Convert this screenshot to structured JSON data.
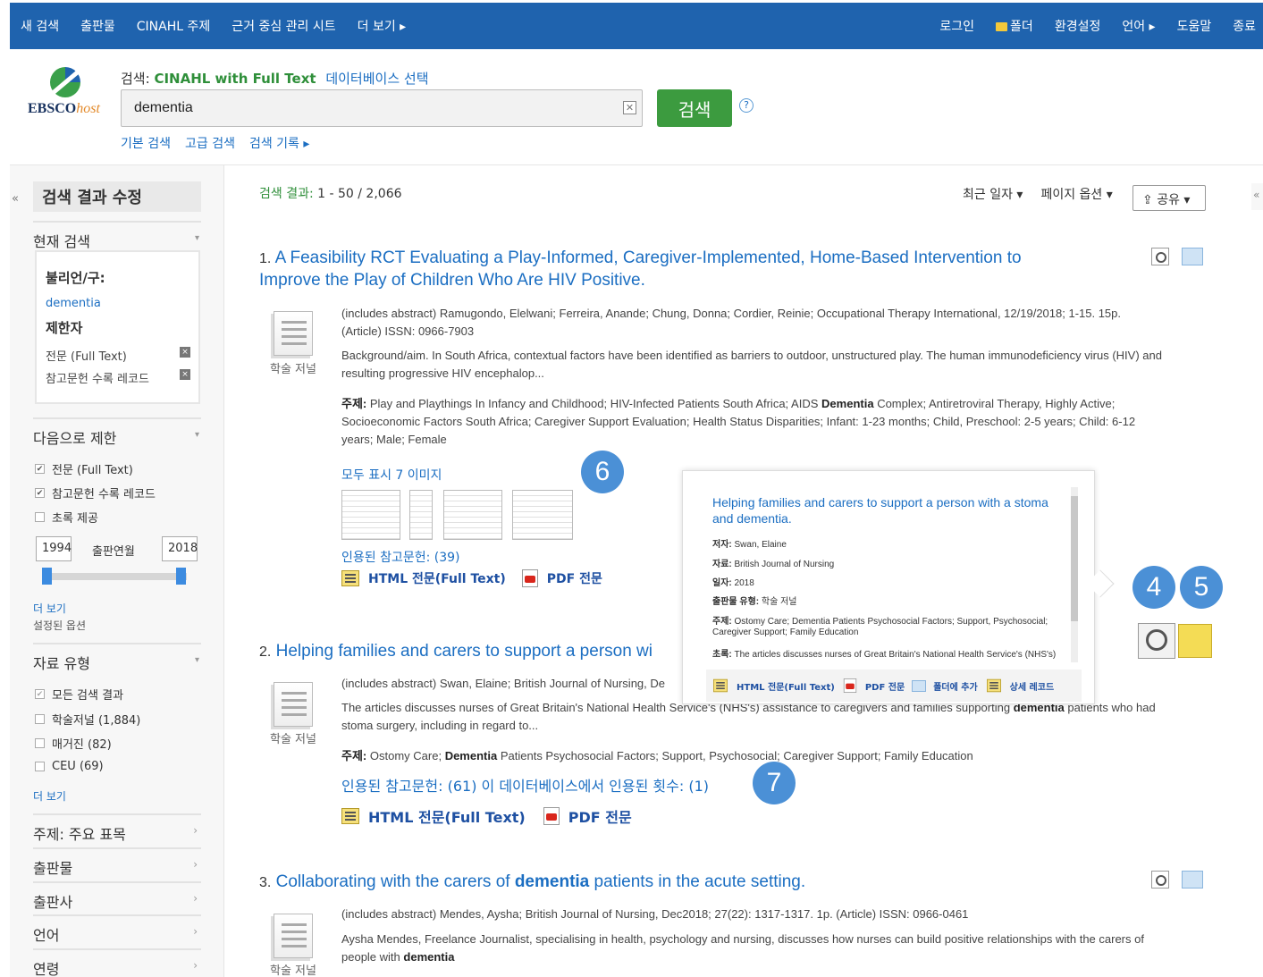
{
  "nav": {
    "left": [
      "새 검색",
      "출판물",
      "CINAHL 주제",
      "근거 중심 관리 시트",
      "더 보기 ▸"
    ],
    "login": "로그인",
    "folder": "폴더",
    "prefs": "환경설정",
    "language": "언어 ▸",
    "help": "도움말",
    "exit": "종료"
  },
  "search": {
    "db_prefix": "검색:",
    "db_name": "CINAHL with Full Text",
    "db_select": "데이터베이스 선택",
    "query": "dementia",
    "button": "검색",
    "help": "?",
    "links": [
      "기본 검색",
      "고급 검색",
      "검색 기록 ▸"
    ]
  },
  "logo": {
    "brand": "EBSCO",
    "suffix": "host"
  },
  "sidebar": {
    "collapse": "«",
    "title": "검색 결과 수정",
    "current_search": "현재 검색",
    "boolean_label": "불리언/구:",
    "boolean_value": "dementia",
    "limiters_label": "제한자",
    "limiters": [
      "전문 (Full Text)",
      "참고문헌 수록 레코드"
    ],
    "limit_to": "다음으로 제한",
    "limit_options": [
      {
        "label": "전문 (Full Text)",
        "checked": true
      },
      {
        "label": "참고문헌 수록 레코드",
        "checked": true
      },
      {
        "label": "초록 제공",
        "checked": false
      }
    ],
    "year_from": "1994",
    "year_label": "출판연월",
    "year_to": "2018",
    "more": "더 보기",
    "set_options": "설정된 옵션",
    "source_type": "자료 유형",
    "source_options": [
      {
        "label": "모든 검색 결과",
        "checked": true
      },
      {
        "label": "학술저널 (1,884)",
        "checked": false
      },
      {
        "label": "매거진 (82)",
        "checked": false
      },
      {
        "label": "CEU (69)",
        "checked": false
      }
    ],
    "more2": "더 보기",
    "facets": [
      "주제: 주요 표목",
      "출판물",
      "출판사",
      "언어",
      "연령"
    ]
  },
  "results": {
    "count_label": "검색 결과:",
    "count": "1 - 50 / 2,066",
    "sort": "최근 일자 ▾",
    "page_options": "페이지 옵션 ▾",
    "share": "공유 ▾",
    "items": [
      {
        "num": "1.",
        "title_line1": "A Feasibility RCT Evaluating a Play-Informed, Caregiver-Implemented, Home-Based Intervention to",
        "title_line2": "Improve the Play of Children Who Are HIV Positive.",
        "type": "학술 저널",
        "meta1": "(includes abstract) Ramugondo, Elelwani; Ferreira, Anande; Chung, Donna; Cordier, Reinie; Occupational Therapy International, 12/19/2018; 1-15. 15p.",
        "meta2": "(Article) ISSN: 0966-7903",
        "abs1": "Background/aim. In South Africa, contextual factors have been identified as barriers to outdoor, unstructured play. The human immunodeficiency virus (HIV) and",
        "abs2": "resulting progressive HIV encephalop...",
        "subj_label": "주제:",
        "subj1a": "Play and Playthings In Infancy and Childhood; HIV-Infected Patients South Africa; AIDS",
        "subj1b": "Dementia",
        "subj1c": "Complex; Antiretroviral Therapy, Highly Active;",
        "subj2": "Socioeconomic Factors South Africa; Caregiver Support Evaluation; Health Status Disparities; Infant: 1-23 months; Child, Preschool: 2-5 years; Child: 6-12",
        "subj3": "years; Male; Female",
        "show_images": "모두 표시 7 이미지",
        "cited": "인용된 참고문헌: (39)",
        "html": "HTML 전문(Full Text)",
        "pdf": "PDF 전문"
      },
      {
        "num": "2.",
        "title": "Helping families and carers to support a person wi",
        "type": "학술 저널",
        "meta1": "(includes abstract) Swan, Elaine; British Journal of Nursing, De",
        "abs1a": "The articles discusses nurses of Great Britain's National Health",
        "abs1b": "Service's (NHS's) assistance to caregivers and families supporting",
        "abs1c": "dementia",
        "abs1d": "patients who had",
        "abs2": "stoma surgery, including in regard to...",
        "subj_label": "주제:",
        "subja": "Ostomy Care;",
        "subjb": "Dementia",
        "subjc": "Patients Psychosocial Factors; Support, Psychosocial; Caregiver Support; Family Education",
        "cited": "인용된 참고문헌: (61) 이 데이터베이스에서 인용된 횟수: (1)",
        "html": "HTML 전문(Full Text)",
        "pdf": "PDF 전문"
      },
      {
        "num": "3.",
        "title_a": "Collaborating with the carers of",
        "title_b": "dementia",
        "title_c": "patients in the acute setting.",
        "type": "학술 저널",
        "meta1": "(includes abstract) Mendes, Aysha; British Journal of Nursing, Dec2018; 27(22): 1317-1317. 1p. (Article) ISSN: 0966-0461",
        "abs1": "Aysha Mendes, Freelance Journalist, specialising in health, psychology and nursing, discusses how nurses can build positive relationships with the carers of",
        "abs2a": "people with",
        "abs2b": "dementia"
      }
    ]
  },
  "popup": {
    "title": "Helping families and carers to support a person with a stoma and dementia.",
    "rows": [
      {
        "k": "저자:",
        "v": "Swan, Elaine"
      },
      {
        "k": "자료:",
        "v": "British Journal of Nursing"
      },
      {
        "k": "일자:",
        "v": "2018"
      },
      {
        "k": "출판물 유형:",
        "v": "학술 저널"
      },
      {
        "k": "주제:",
        "v": "Ostomy Care; Dementia Patients Psychosocial Factors; Support, Psychosocial;"
      },
      {
        "k": "",
        "v": "Caregiver Support; Family Education"
      },
      {
        "k": "초록:",
        "v": "The articles discusses nurses of Great Britain's National Health Service's (NHS's)"
      }
    ],
    "html": "HTML 전문(Full Text)",
    "pdf": "PDF 전문",
    "add_folder": "폴더에 추가",
    "detail": "상세 레코드"
  },
  "badges": [
    "4",
    "5",
    "6",
    "7"
  ],
  "colors": {
    "nav": "#1f63ae",
    "link": "#1b6ec2",
    "green": "#3c9b3f",
    "badge": "#4b90d6"
  }
}
